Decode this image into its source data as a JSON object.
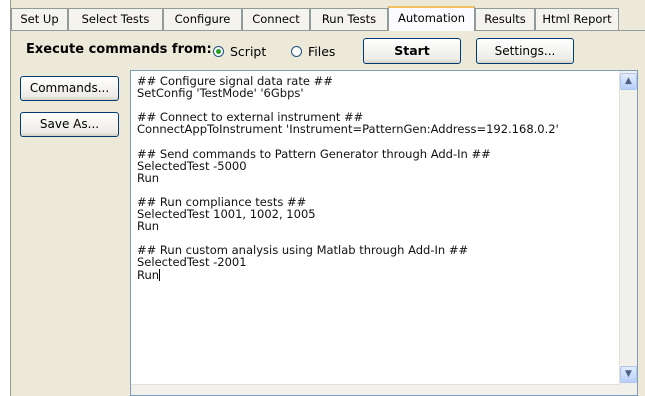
{
  "tabs": [
    {
      "label": "Set Up",
      "active": false
    },
    {
      "label": "Select Tests",
      "active": false
    },
    {
      "label": "Configure",
      "active": false
    },
    {
      "label": "Connect",
      "active": false
    },
    {
      "label": "Run Tests",
      "active": false
    },
    {
      "label": "Automation",
      "active": true
    },
    {
      "label": "Results",
      "active": false
    },
    {
      "label": "Html Report",
      "active": false
    }
  ],
  "execute": {
    "label": "Execute commands from:",
    "options": [
      "Script",
      "Files"
    ],
    "selected": "Script",
    "start_label": "Start",
    "settings_label": "Settings..."
  },
  "side_buttons": {
    "commands_label": "Commands...",
    "save_as_label": "Save As..."
  },
  "script": {
    "lines": [
      "## Configure signal data rate ##",
      "SetConfig 'TestMode' '6Gbps'",
      "",
      "## Connect to external instrument ##",
      "ConnectAppToInstrument 'Instrument=PatternGen:Address=192.168.0.2'",
      "",
      "## Send commands to Pattern Generator through Add-In ##",
      "SelectedTest -5000",
      "Run",
      "",
      "## Run compliance tests ##",
      "SelectedTest 1001, 1002, 1005",
      "Run",
      "",
      "## Run custom analysis using Matlab through Add-In ##",
      "SelectedTest -2001",
      "Run"
    ]
  },
  "icons": {
    "scroll_up": "scroll-up-arrow-icon",
    "scroll_down": "scroll-down-arrow-icon"
  }
}
